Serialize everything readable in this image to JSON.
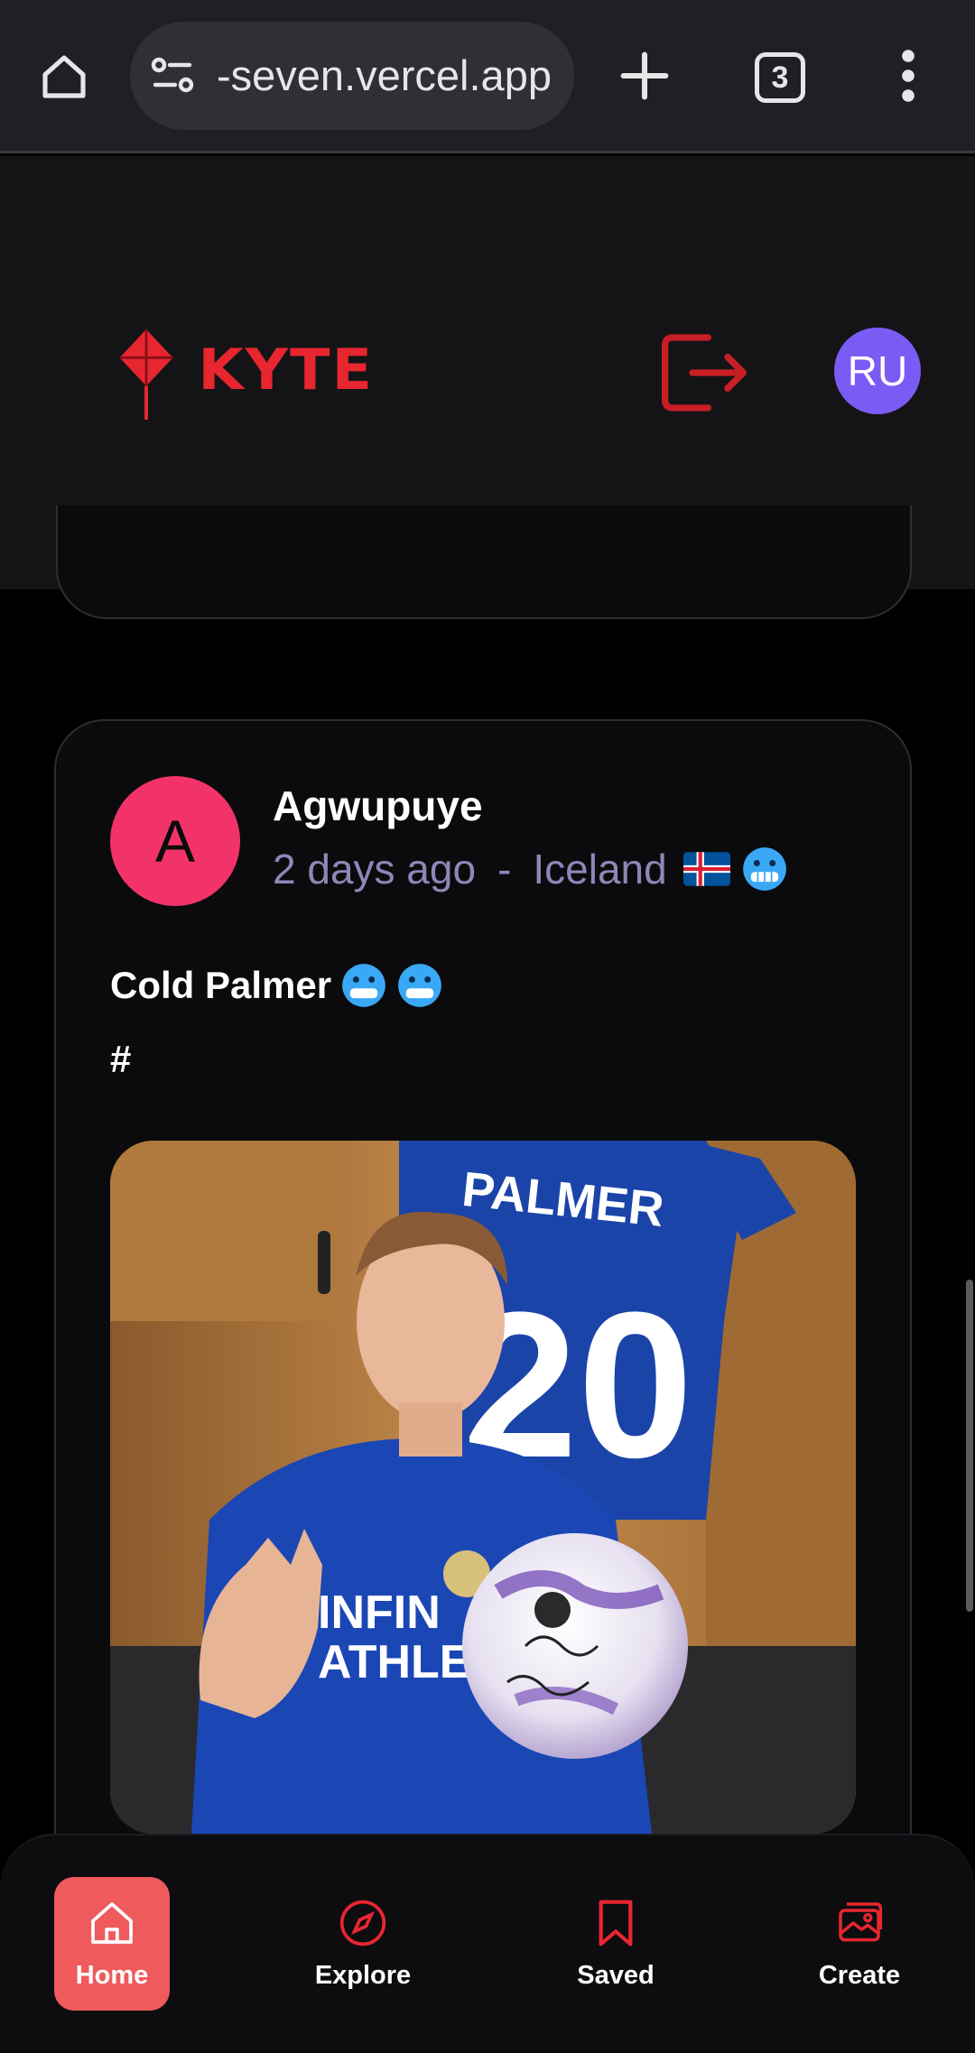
{
  "browser": {
    "url_text": "-seven.vercel.app",
    "tab_count": "3"
  },
  "header": {
    "brand": "KYTE",
    "user_initials": "RU",
    "accent_color": "#e8262f",
    "avatar_color": "#7a5cf5"
  },
  "post": {
    "author_initial": "A",
    "author": "Agwupuye",
    "time": "2 days ago",
    "separator": "-",
    "location": "Iceland",
    "caption": "Cold Palmer",
    "hashtag": "#",
    "image_jersey_name": "PALMER",
    "image_jersey_number": "20",
    "image_shirt_text_1": "INFIN",
    "image_shirt_text_2": "ATHLE",
    "avatar_color": "#f2336a"
  },
  "nav": {
    "items": [
      {
        "label": "Home",
        "icon": "home-icon",
        "active": true
      },
      {
        "label": "Explore",
        "icon": "compass-icon",
        "active": false
      },
      {
        "label": "Saved",
        "icon": "bookmark-icon",
        "active": false
      },
      {
        "label": "Create",
        "icon": "gallery-add-icon",
        "active": false
      }
    ]
  }
}
